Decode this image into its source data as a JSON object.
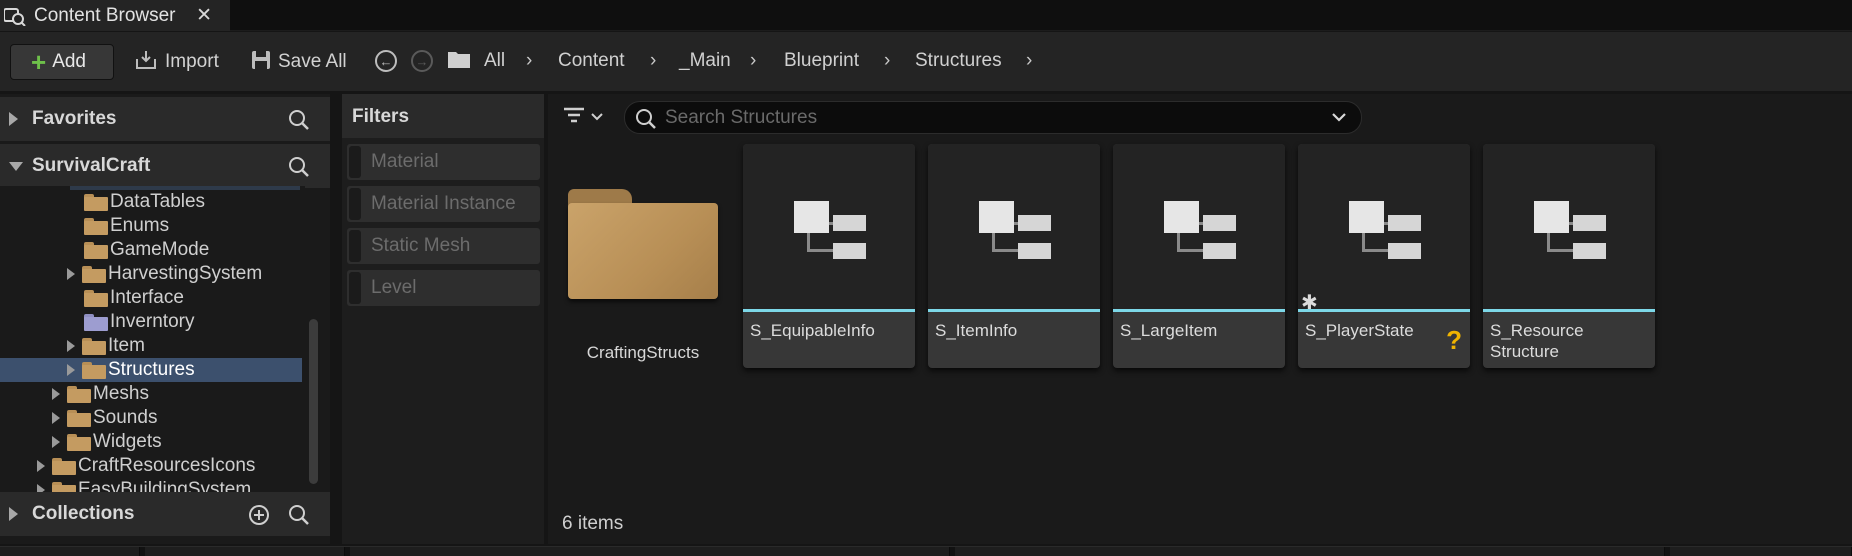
{
  "tab": {
    "title": "Content Browser",
    "close": "✕",
    "icon": "content-browser-icon"
  },
  "toolbar": {
    "add_label": "Add",
    "import_label": "Import",
    "save_all_label": "Save All"
  },
  "breadcrumb": [
    "All",
    "Content",
    "_Main",
    "Blueprint",
    "Structures"
  ],
  "sidebar": {
    "favorites": "Favorites",
    "project": "SurvivalCraft",
    "collections": "Collections",
    "tree": [
      {
        "label": "DataTables"
      },
      {
        "label": "Enums"
      },
      {
        "label": "GameMode"
      },
      {
        "label": "HarvestingSystem"
      },
      {
        "label": "Interface"
      },
      {
        "label": "Inverntory"
      },
      {
        "label": "Item"
      },
      {
        "label": "Structures"
      },
      {
        "label": "Meshs"
      },
      {
        "label": "Sounds"
      },
      {
        "label": "Widgets"
      },
      {
        "label": "CraftResourcesIcons"
      },
      {
        "label": "EasyBuildingSystem"
      }
    ]
  },
  "filters": {
    "title": "Filters",
    "items": [
      "Material",
      "Material Instance",
      "Static Mesh",
      "Level"
    ]
  },
  "search": {
    "placeholder": "Search Structures"
  },
  "content": {
    "folder_name": "CraftingStructs",
    "assets": [
      {
        "name": "S_EquipableInfo",
        "type": "Structure"
      },
      {
        "name": "S_ItemInfo",
        "type": "Structure"
      },
      {
        "name": "S_LargeItem",
        "type": "Structure"
      },
      {
        "name": "S_PlayerState",
        "type": "Structure",
        "star": "✱",
        "question": "?"
      },
      {
        "name": "S_Resource Structure",
        "type": "Structure"
      }
    ],
    "item_count": "6 items"
  },
  "colors": {
    "accent_structure": "#7dd8e8",
    "folder": "#c49b61",
    "add_plus": "#6ec04a",
    "selected_row": "#3c506d",
    "warning": "#f0b400"
  }
}
